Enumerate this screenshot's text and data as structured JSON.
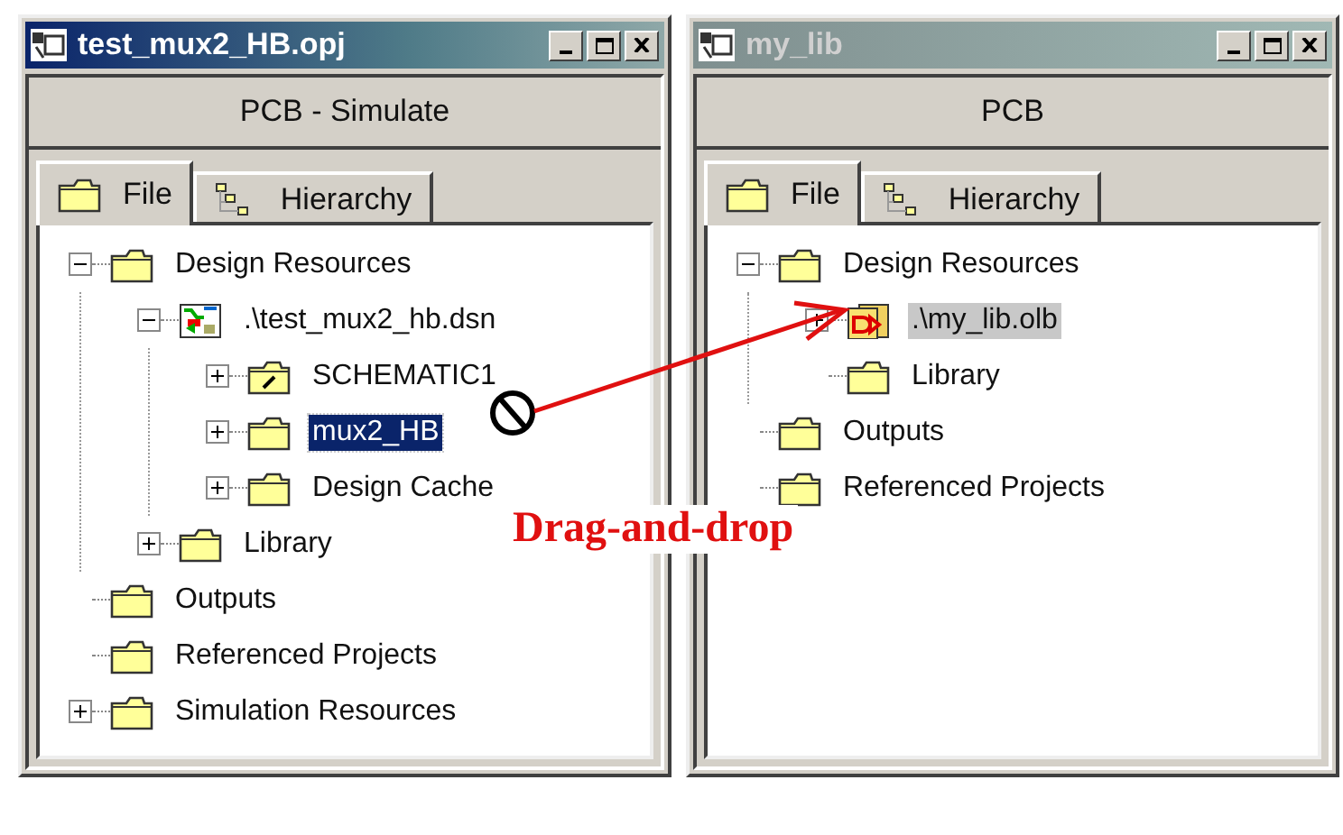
{
  "windows": [
    {
      "title": "test_mux2_HB.opj",
      "active": true,
      "header": "PCB - Simulate",
      "tabs": [
        {
          "label": "File",
          "kind": "folder",
          "selected": true
        },
        {
          "label": "Hierarchy",
          "kind": "hierarchy",
          "selected": false
        }
      ],
      "tree": [
        {
          "label": "Design Resources",
          "kind": "folder",
          "expanded": true,
          "selected": false,
          "drop_target": false,
          "children": [
            {
              "label": ".\\test_mux2_hb.dsn",
              "kind": "design",
              "expanded": true,
              "selected": false,
              "drop_target": false,
              "children": [
                {
                  "label": "SCHEMATIC1",
                  "kind": "schematic",
                  "expanded": false,
                  "selected": false,
                  "drop_target": false
                },
                {
                  "label": "mux2_HB",
                  "kind": "folder",
                  "expanded": false,
                  "selected": true,
                  "drop_target": false
                },
                {
                  "label": "Design Cache",
                  "kind": "folder",
                  "expanded": false,
                  "selected": false,
                  "drop_target": false
                }
              ]
            },
            {
              "label": "Library",
              "kind": "folder",
              "expanded": false,
              "selected": false,
              "drop_target": false
            }
          ]
        },
        {
          "label": "Outputs",
          "kind": "folder",
          "selected": false,
          "drop_target": false
        },
        {
          "label": "Referenced Projects",
          "kind": "folder",
          "selected": false,
          "drop_target": false
        },
        {
          "label": "Simulation Resources",
          "kind": "folder",
          "expanded": false,
          "selected": false,
          "drop_target": false
        }
      ]
    },
    {
      "title": "my_lib",
      "active": false,
      "header": "PCB",
      "tabs": [
        {
          "label": "File",
          "kind": "folder",
          "selected": true
        },
        {
          "label": "Hierarchy",
          "kind": "hierarchy",
          "selected": false
        }
      ],
      "tree": [
        {
          "label": "Design Resources",
          "kind": "folder",
          "expanded": true,
          "selected": false,
          "drop_target": false,
          "children": [
            {
              "label": ".\\my_lib.olb",
              "kind": "library",
              "expanded": false,
              "selected": false,
              "drop_target": true
            },
            {
              "label": "Library",
              "kind": "folder",
              "selected": false,
              "drop_target": false
            }
          ]
        },
        {
          "label": "Outputs",
          "kind": "folder",
          "selected": false,
          "drop_target": false
        },
        {
          "label": "Referenced Projects",
          "kind": "folder",
          "selected": false,
          "drop_target": false
        }
      ]
    }
  ],
  "annotation": {
    "label": "Drag-and-drop"
  }
}
